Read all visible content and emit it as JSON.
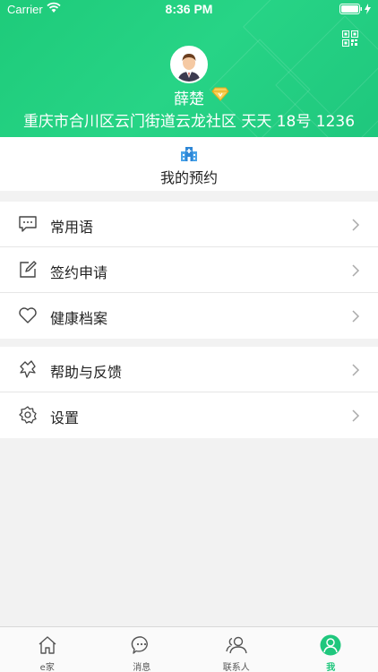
{
  "status": {
    "carrier": "Carrier",
    "time": "8:36 PM"
  },
  "profile": {
    "name": "薛楚",
    "address": "重庆市合川区云门街道云龙社区 天天 18号 1236"
  },
  "appointment": {
    "label": "我的预约"
  },
  "menu_group1": [
    {
      "label": "常用语",
      "icon": "chat-icon"
    },
    {
      "label": "签约申请",
      "icon": "edit-icon"
    },
    {
      "label": "健康档案",
      "icon": "heart-icon"
    }
  ],
  "menu_group2": [
    {
      "label": "帮助与反馈",
      "icon": "help-icon"
    },
    {
      "label": "设置",
      "icon": "gear-icon"
    }
  ],
  "tabs": [
    {
      "label": "e家",
      "icon": "home-icon"
    },
    {
      "label": "消息",
      "icon": "message-icon"
    },
    {
      "label": "联系人",
      "icon": "contacts-icon"
    },
    {
      "label": "我",
      "icon": "person-icon"
    }
  ],
  "colors": {
    "accent": "#1fc77d",
    "header": "#22cd80"
  }
}
